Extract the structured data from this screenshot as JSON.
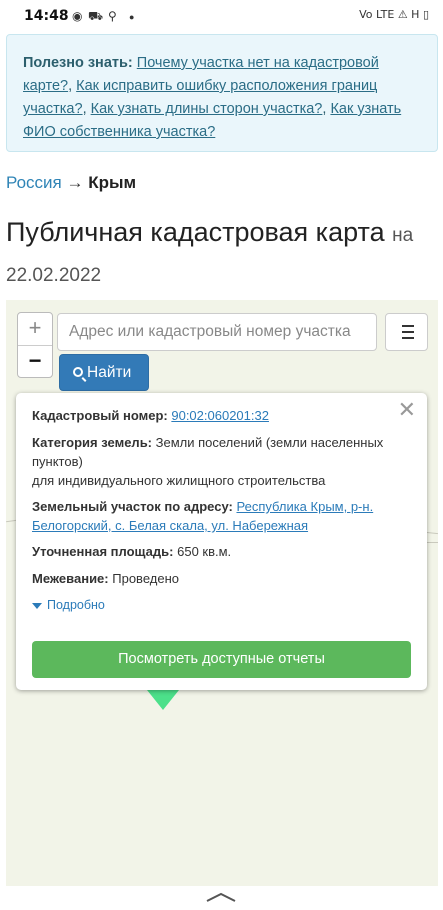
{
  "status_bar": {
    "time": "14:48",
    "right_text": "Vo LTE ⚠ H ▯"
  },
  "info": {
    "label": "Полезно знать:",
    "links": [
      "Почему участка нет на кадастровой карте?",
      "Как исправить ошибку расположения границ участка?",
      "Как узнать длины сторон участка?",
      "Как узнать ФИО собственника участка?"
    ]
  },
  "breadcrumb": {
    "parent": "Россия",
    "separator": "→",
    "current": "Крым"
  },
  "page": {
    "title": "Публичная кадастровая карта",
    "date_prefix": "на",
    "date": "22.02.2022"
  },
  "map": {
    "zoom_in": "+",
    "zoom_out": "−",
    "search_placeholder": "Адрес или кадастровый номер участка",
    "find_label": "Найти",
    "parcel_color": "#4ce08a"
  },
  "popup": {
    "cadastral_label": "Кадастровый номер:",
    "cadastral_value": "90:02:060201:32",
    "category_label": "Категория земель:",
    "category_value": "Земли поселений (земли населенных пунктов)",
    "category_use": "для индивидуального жилищного строительства",
    "address_label": "Земельный участок по адресу:",
    "address_value": "Республика Крым, р-н. Белогорский, с. Белая скала, ул. Набережная",
    "area_label": "Уточненная площадь:",
    "area_value": "650 кв.м.",
    "survey_label": "Межевание:",
    "survey_value": "Проведено",
    "more_label": "Подробно",
    "reports_button": "Посмотреть доступные отчеты",
    "close": "✕"
  },
  "colors": {
    "primary": "#337ab7",
    "success": "#5cb85c",
    "link": "#2b7bb9",
    "info_bg": "#eaf6fb"
  }
}
